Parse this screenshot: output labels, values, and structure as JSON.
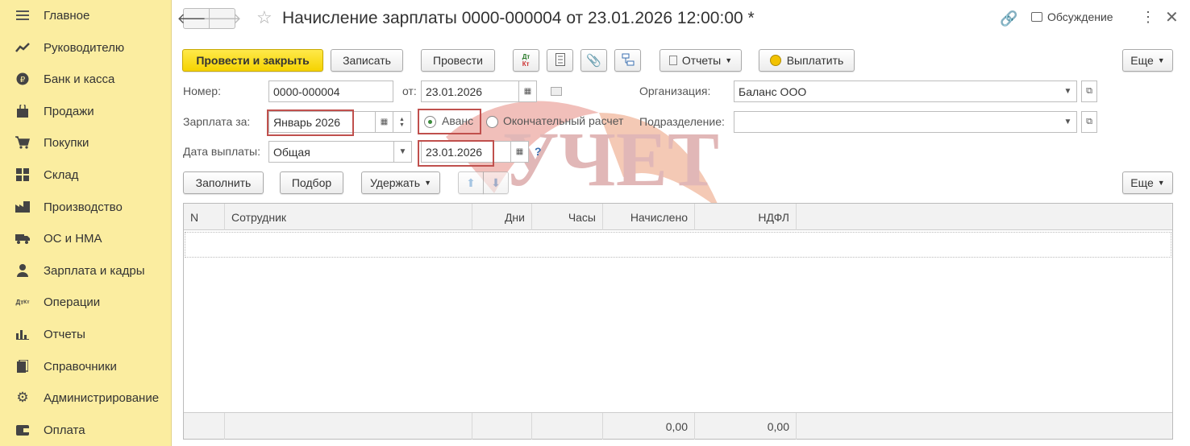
{
  "sidebar": {
    "items": [
      {
        "label": "Главное",
        "icon": "menu-icon"
      },
      {
        "label": "Руководителю",
        "icon": "trend-icon"
      },
      {
        "label": "Банк и касса",
        "icon": "ruble-icon"
      },
      {
        "label": "Продажи",
        "icon": "bag-icon"
      },
      {
        "label": "Покупки",
        "icon": "cart-icon"
      },
      {
        "label": "Склад",
        "icon": "grid-icon"
      },
      {
        "label": "Производство",
        "icon": "factory-icon"
      },
      {
        "label": "ОС и НМА",
        "icon": "truck-icon"
      },
      {
        "label": "Зарплата и кадры",
        "icon": "person-icon"
      },
      {
        "label": "Операции",
        "icon": "dt-kt-icon"
      },
      {
        "label": "Отчеты",
        "icon": "bar-chart-icon"
      },
      {
        "label": "Справочники",
        "icon": "books-icon"
      },
      {
        "label": "Администрирование",
        "icon": "gear-icon"
      },
      {
        "label": "Оплата",
        "icon": "wallet-icon"
      }
    ]
  },
  "header": {
    "title": "Начисление зарплаты 0000-000004 от 23.01.2026 12:00:00 *",
    "discuss_label": "Обсуждение"
  },
  "toolbar": {
    "post_close": "Провести и закрыть",
    "save": "Записать",
    "post": "Провести",
    "reports": "Отчеты",
    "pay": "Выплатить",
    "more": "Еще"
  },
  "form": {
    "number_label": "Номер:",
    "number_value": "0000-000004",
    "date_label": "от:",
    "date_value": "23.01.2026",
    "org_label": "Организация:",
    "org_value": "Баланс ООО",
    "salary_for_label": "Зарплата за:",
    "salary_for_value": "Январь 2026",
    "advance_label": "Аванс",
    "final_label": "Окончательный расчет",
    "dept_label": "Подразделение:",
    "dept_value": "",
    "pay_date_label": "Дата выплаты:",
    "pay_date_type": "Общая",
    "pay_date_value": "23.01.2026",
    "help": "?"
  },
  "table_toolbar": {
    "fill": "Заполнить",
    "select": "Подбор",
    "withhold": "Удержать",
    "more": "Еще"
  },
  "table": {
    "columns": [
      "N",
      "Сотрудник",
      "Дни",
      "Часы",
      "Начислено",
      "НДФЛ"
    ],
    "totals": {
      "accrued": "0,00",
      "ndfl": "0,00"
    }
  },
  "colors": {
    "sidebar_bg": "#fbeda0",
    "primary_button": "#f5d300",
    "highlight": "#c0504d"
  }
}
